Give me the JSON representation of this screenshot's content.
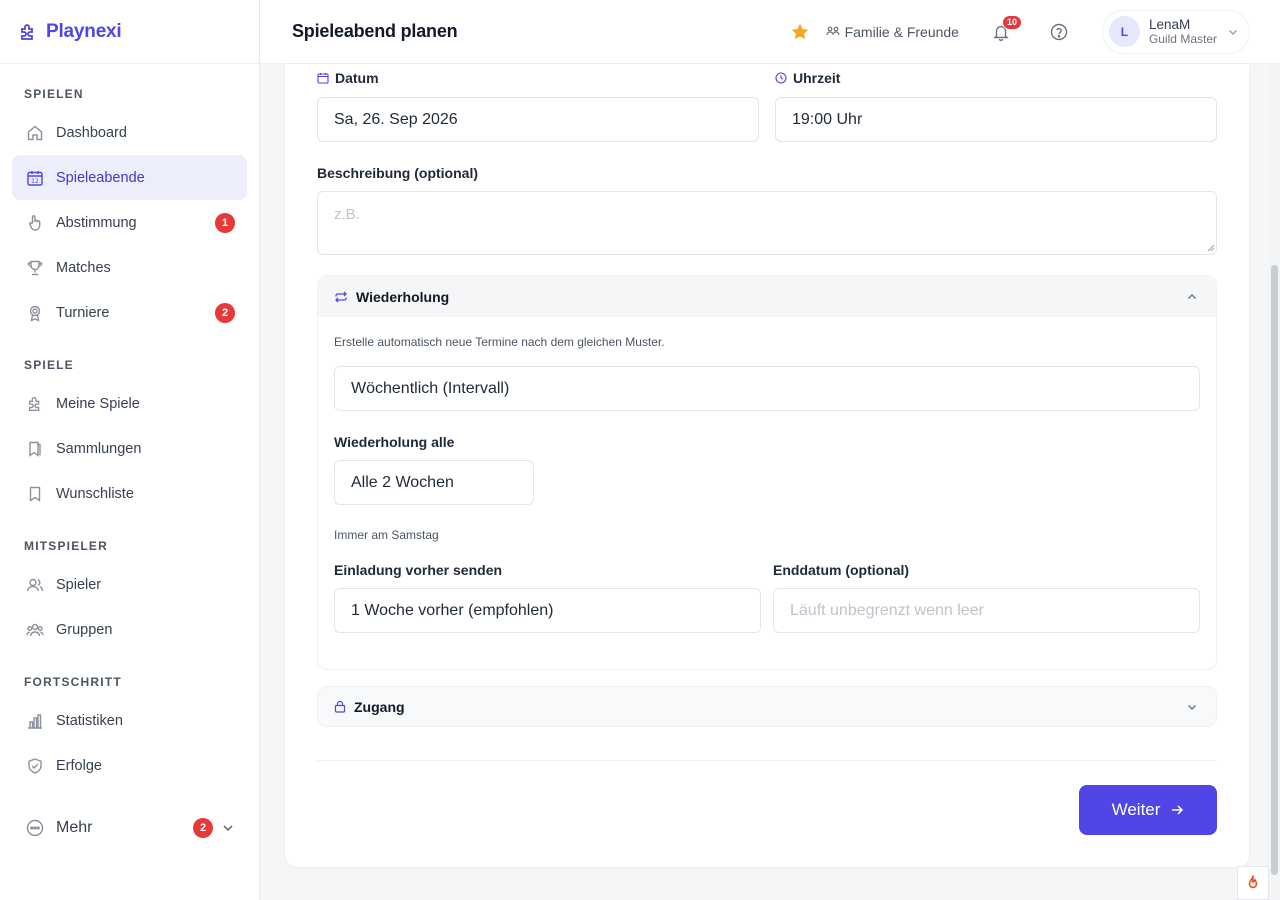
{
  "brand": {
    "name": "Playnexi"
  },
  "sidebar": {
    "sections": [
      {
        "title": "SPIELEN",
        "items": [
          {
            "label": "Dashboard",
            "icon": "home-icon"
          },
          {
            "label": "Spieleabende",
            "icon": "calendar-icon",
            "active": true
          },
          {
            "label": "Abstimmung",
            "icon": "hand-icon",
            "badge": "1"
          },
          {
            "label": "Matches",
            "icon": "trophy-icon"
          },
          {
            "label": "Turniere",
            "icon": "medal-icon",
            "badge": "2"
          }
        ]
      },
      {
        "title": "SPIELE",
        "items": [
          {
            "label": "Meine Spiele",
            "icon": "puzzle-icon"
          },
          {
            "label": "Sammlungen",
            "icon": "bookmarks-icon"
          },
          {
            "label": "Wunschliste",
            "icon": "bookmark-icon"
          }
        ]
      },
      {
        "title": "MITSPIELER",
        "items": [
          {
            "label": "Spieler",
            "icon": "users-icon"
          },
          {
            "label": "Gruppen",
            "icon": "group-icon"
          }
        ]
      },
      {
        "title": "FORTSCHRITT",
        "items": [
          {
            "label": "Statistiken",
            "icon": "bar-chart-icon"
          },
          {
            "label": "Erfolge",
            "icon": "shield-check-icon"
          }
        ]
      }
    ],
    "more": {
      "label": "Mehr",
      "badge": "2"
    }
  },
  "header": {
    "title": "Spieleabend planen",
    "context": "Familie & Freunde",
    "notifications": "10",
    "user": {
      "initial": "L",
      "name": "LenaM",
      "role": "Guild Master"
    }
  },
  "form": {
    "date": {
      "label": "Datum",
      "value": "Sa, 26. Sep 2026"
    },
    "time": {
      "label": "Uhrzeit",
      "value": "19:00 Uhr"
    },
    "description": {
      "label": "Beschreibung (optional)",
      "placeholder": "z.B."
    },
    "recurrence": {
      "title": "Wiederholung",
      "hint": "Erstelle automatisch neue Termine nach dem gleichen Muster.",
      "mode": "Wöchentlich (Intervall)",
      "interval_label": "Wiederholung alle",
      "interval_value": "Alle 2 Wochen",
      "weekday_hint": "Immer am Samstag",
      "invite_label": "Einladung vorher senden",
      "invite_value": "1 Woche vorher (empfohlen)",
      "end_label": "Enddatum (optional)",
      "end_placeholder": "Läuft unbegrenzt wenn leer"
    },
    "access": {
      "title": "Zugang"
    },
    "next_button": "Weiter"
  },
  "colors": {
    "accent": "#4f46e5",
    "badge": "#e5393a",
    "star": "#f5a623"
  }
}
